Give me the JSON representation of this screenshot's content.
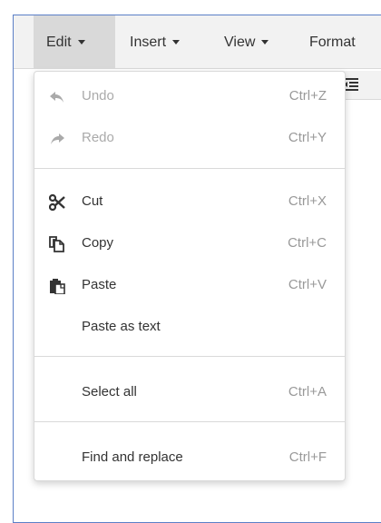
{
  "menubar": {
    "items": [
      {
        "label": "Edit"
      },
      {
        "label": "Insert"
      },
      {
        "label": "View"
      },
      {
        "label": "Format"
      }
    ]
  },
  "edit_menu": {
    "undo": {
      "label": "Undo",
      "shortcut": "Ctrl+Z",
      "icon": "undo-icon",
      "disabled": true
    },
    "redo": {
      "label": "Redo",
      "shortcut": "Ctrl+Y",
      "icon": "redo-icon",
      "disabled": true
    },
    "cut": {
      "label": "Cut",
      "shortcut": "Ctrl+X",
      "icon": "scissors-icon"
    },
    "copy": {
      "label": "Copy",
      "shortcut": "Ctrl+C",
      "icon": "copy-icon"
    },
    "paste": {
      "label": "Paste",
      "shortcut": "Ctrl+V",
      "icon": "paste-icon"
    },
    "paste_text": {
      "label": "Paste as text"
    },
    "select_all": {
      "label": "Select all",
      "shortcut": "Ctrl+A"
    },
    "find_replace": {
      "label": "Find and replace",
      "shortcut": "Ctrl+F"
    }
  },
  "colors": {
    "frame_border": "#5b7fc7",
    "menubar_bg": "#f2f2f2",
    "active_menu_bg": "#d9d9d9",
    "disabled_text": "#aaaaaa",
    "shortcut_text": "#999999"
  }
}
